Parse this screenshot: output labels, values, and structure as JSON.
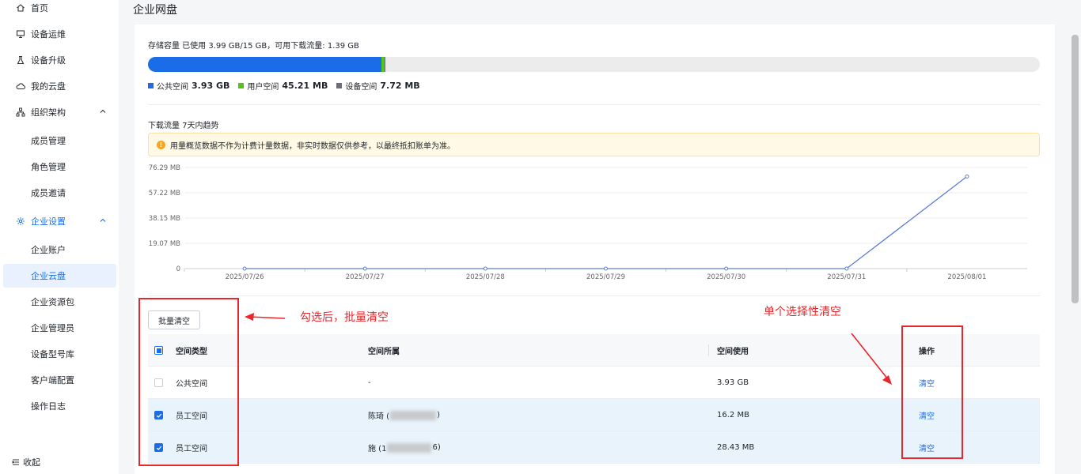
{
  "sidebar": {
    "items": [
      {
        "label": "首页",
        "icon": "home-icon"
      },
      {
        "label": "设备运维",
        "icon": "monitor-icon"
      },
      {
        "label": "设备升级",
        "icon": "flask-icon"
      },
      {
        "label": "我的云盘",
        "icon": "cloud-icon"
      },
      {
        "label": "组织架构",
        "icon": "org-chart-icon"
      },
      {
        "label": "成员管理"
      },
      {
        "label": "角色管理"
      },
      {
        "label": "成员邀请"
      },
      {
        "label": "企业设置",
        "icon": "gear-icon"
      },
      {
        "label": "企业账户"
      },
      {
        "label": "企业云盘"
      },
      {
        "label": "企业资源包"
      },
      {
        "label": "企业管理员"
      },
      {
        "label": "设备型号库"
      },
      {
        "label": "客户端配置"
      },
      {
        "label": "操作日志"
      }
    ],
    "collapse_label": "收起"
  },
  "page": {
    "title": "企业网盘"
  },
  "storage": {
    "summary": "存储容量 已使用 3.99 GB/15 GB，可用下载流量: 1.39 GB",
    "used_fraction_public": 0.262,
    "used_fraction_user": 0.003,
    "used_fraction_device": 0.0005,
    "legend": [
      {
        "label": "公共空间",
        "value": "3.93 GB",
        "color": "#1a6ce8"
      },
      {
        "label": "用户空间",
        "value": "45.21 MB",
        "color": "#52c41a"
      },
      {
        "label": "设备空间",
        "value": "7.72 MB",
        "color": "#6b6f7a"
      }
    ]
  },
  "download": {
    "title": "下载流量 7天内趋势",
    "notice": "用量概览数据不作为计费计量数据，非实时数据仅供参考，以最终抵扣账单为准。"
  },
  "chart_data": {
    "type": "line",
    "x": [
      "2025/07/26",
      "2025/07/27",
      "2025/07/28",
      "2025/07/29",
      "2025/07/30",
      "2025/07/31",
      "2025/08/01"
    ],
    "y_ticks": [
      "0",
      "19.07 MB",
      "38.15 MB",
      "57.22 MB",
      "76.29 MB"
    ],
    "series": [
      {
        "values": [
          0,
          0,
          0,
          0,
          0,
          0,
          69.5
        ]
      }
    ],
    "ylim": [
      0,
      76.29
    ],
    "color": "#5b7fd6",
    "grid": true
  },
  "batch_clear_label": "批量清空",
  "table": {
    "columns": [
      "空间类型",
      "空间所属",
      "空间使用",
      "操作"
    ],
    "rows": [
      {
        "type": "公共空间",
        "owner": "-",
        "usage": "3.93 GB",
        "action": "清空",
        "checked": false
      },
      {
        "type": "员工空间",
        "owner_prefix": "陈琦 (",
        "owner_suffix": ")",
        "usage": "16.2 MB",
        "action": "清空",
        "checked": true
      },
      {
        "type": "员工空间",
        "owner_prefix": "施 (1",
        "owner_suffix": "6)",
        "usage": "28.43 MB",
        "action": "清空",
        "checked": true
      }
    ]
  },
  "annotations": {
    "batch_note": "勾选后，批量清空",
    "single_note": "单个选择性清空"
  }
}
